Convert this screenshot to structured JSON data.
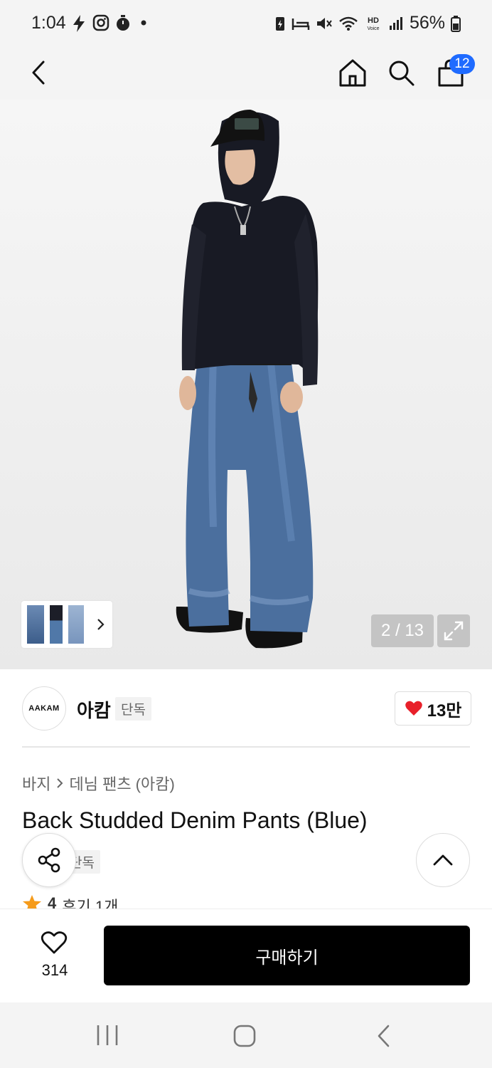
{
  "status_bar": {
    "time": "1:04",
    "battery": "56%",
    "hd_label": "HD",
    "voice_label": "Voice"
  },
  "header": {
    "cart_count": "12"
  },
  "gallery": {
    "counter": "2 / 13"
  },
  "brand": {
    "logo_text": "AAKAM",
    "name": "아캄",
    "exclusive_tag": "단독",
    "likes": "13만"
  },
  "breadcrumb": {
    "category": "바지",
    "subcategory": "데님 팬츠 (아캄)"
  },
  "product": {
    "title": "Back Studded Denim Pants (Blue)",
    "tag": "단독",
    "rating": "4",
    "reviews": "후기 1개"
  },
  "bottom_bar": {
    "wish_count": "314",
    "buy_label": "구매하기"
  },
  "colors": {
    "accent": "#1f6bff",
    "heart": "#e8202a",
    "star": "#f59b1a"
  }
}
